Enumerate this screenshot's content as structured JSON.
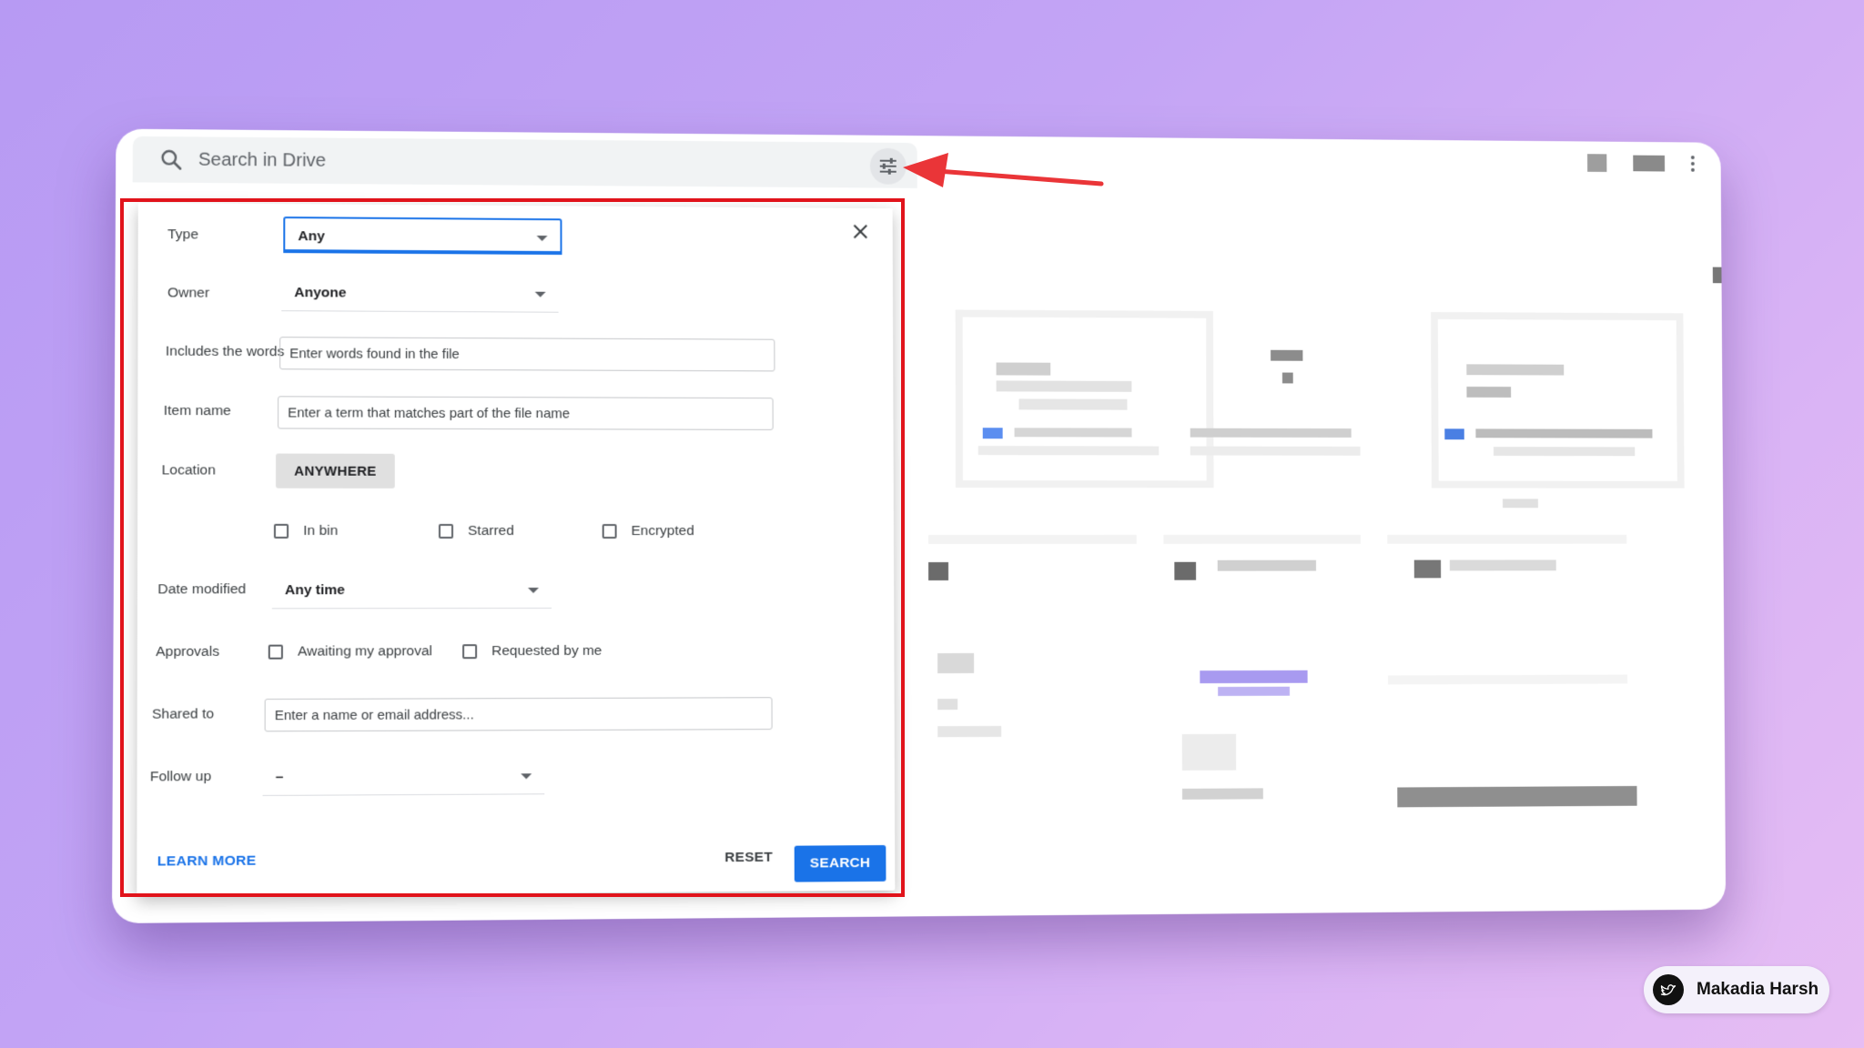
{
  "search": {
    "placeholder": "Search in Drive"
  },
  "panel": {
    "type": {
      "label": "Type",
      "value": "Any"
    },
    "owner": {
      "label": "Owner",
      "value": "Anyone"
    },
    "includes": {
      "label": "Includes the words",
      "placeholder": "Enter words found in the file"
    },
    "item_name": {
      "label": "Item name",
      "placeholder": "Enter a term that matches part of the file name"
    },
    "location": {
      "label": "Location",
      "button": "ANYWHERE"
    },
    "checks": {
      "in_bin": "In bin",
      "starred": "Starred",
      "encrypted": "Encrypted"
    },
    "date_modified": {
      "label": "Date modified",
      "value": "Any time"
    },
    "approvals": {
      "label": "Approvals",
      "awaiting": "Awaiting my approval",
      "requested": "Requested by me"
    },
    "shared_to": {
      "label": "Shared to",
      "placeholder": "Enter a name or email address..."
    },
    "follow_up": {
      "label": "Follow up",
      "value": "–"
    },
    "learn_more": "LEARN MORE",
    "reset": "RESET",
    "search": "SEARCH"
  },
  "badge": {
    "name": "Makadia Harsh"
  },
  "colors": {
    "accent": "#1a73e8",
    "highlight": "#e1131b"
  }
}
